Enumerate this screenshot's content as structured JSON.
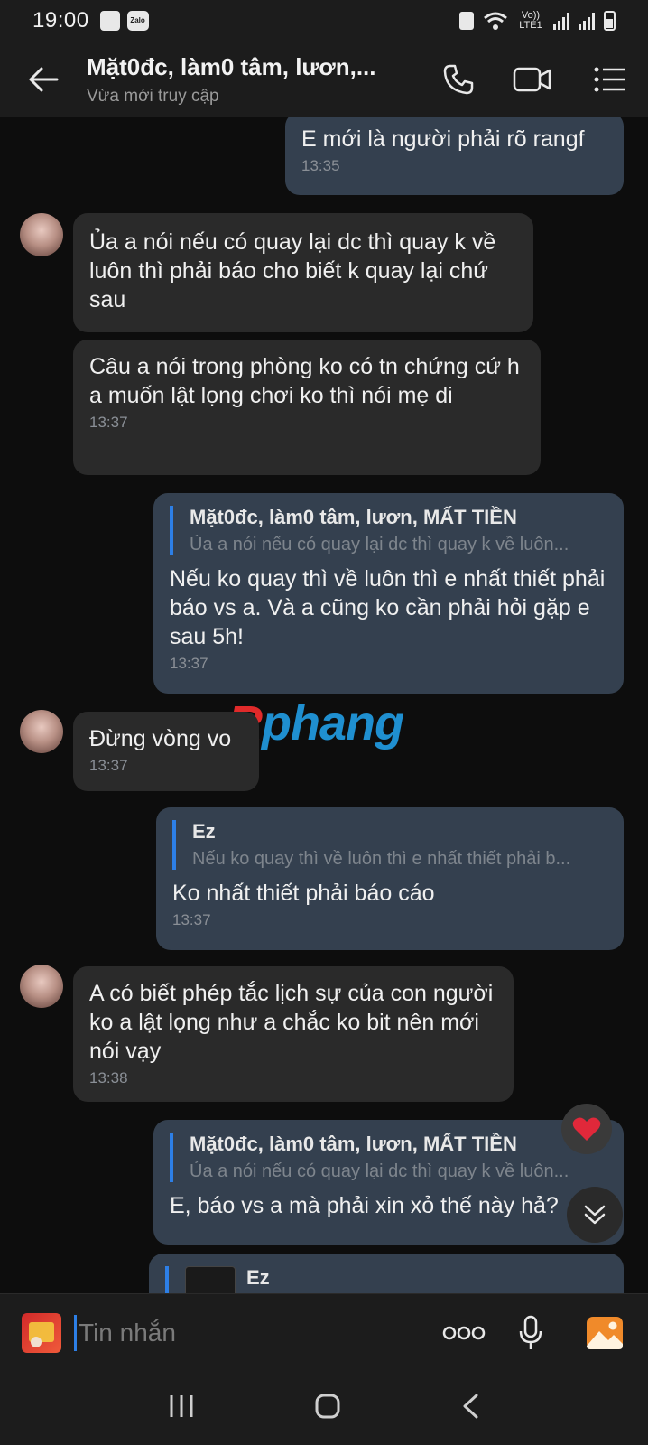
{
  "status_bar": {
    "time": "19:00",
    "zalo_label": "Zalo",
    "volte_label": "Vo)) LTE1"
  },
  "header": {
    "title": "Mặt0đc, làm0 tâm, lươn,...",
    "subtitle": "Vừa mới truy cập"
  },
  "messages": [
    {
      "direction": "out",
      "text": "E mới là người phải rõ rangf",
      "time": "13:35"
    },
    {
      "direction": "in",
      "text": "Ủa a nói nếu có quay lại dc  thì quay k về luôn thì phải báo cho biết k quay lại chứ sau",
      "time": ""
    },
    {
      "direction": "in",
      "text": "Câu a nói trong phòng ko có tn chứng cứ h a muốn lật lọng chơi ko thì nói mẹ di",
      "time": "13:37"
    },
    {
      "direction": "out",
      "quote_name": "Mặt0đc, làm0 tâm, lươn, MẤT TIỀN",
      "quote_text": "Ủa a nói nếu có quay lại dc  thì quay k về luôn...",
      "text": "Nếu ko quay thì về luôn thì e nhất thiết phải báo vs a. Và a cũng ko cần phải hỏi gặp e sau 5h!",
      "time": "13:37"
    },
    {
      "direction": "in",
      "text": "Đừng vòng vo",
      "time": "13:37"
    },
    {
      "direction": "out",
      "quote_name": "Ez",
      "quote_text": "Nếu ko quay thì về luôn thì e nhất thiết phải b...",
      "text": "Ko nhất thiết phải báo cáo",
      "time": "13:37"
    },
    {
      "direction": "in",
      "text": "A có biết phép tắc lịch sự của con người ko a lật lọng như a chắc ko bit nên mới nói vạy",
      "time": "13:38"
    },
    {
      "direction": "out",
      "quote_name": "Mặt0đc, làm0 tâm, lươn, MẤT TIỀN",
      "quote_text": "Ủa a nói nếu có quay lại dc  thì quay k về luôn...",
      "text": "E, báo vs a mà phải xin xỏ thế này hả?",
      "time": ""
    },
    {
      "direction": "out",
      "quote_name": "Ez",
      "quote_text": "",
      "text": "",
      "time": ""
    }
  ],
  "watermark": {
    "r": "R",
    "rest": "phang"
  },
  "input": {
    "placeholder": "Tin nhắn"
  },
  "colors": {
    "accent": "#2d7fe6",
    "outgoing_bubble": "#34404f",
    "incoming_bubble": "#2a2a2a",
    "reaction_heart": "#e0283a"
  }
}
